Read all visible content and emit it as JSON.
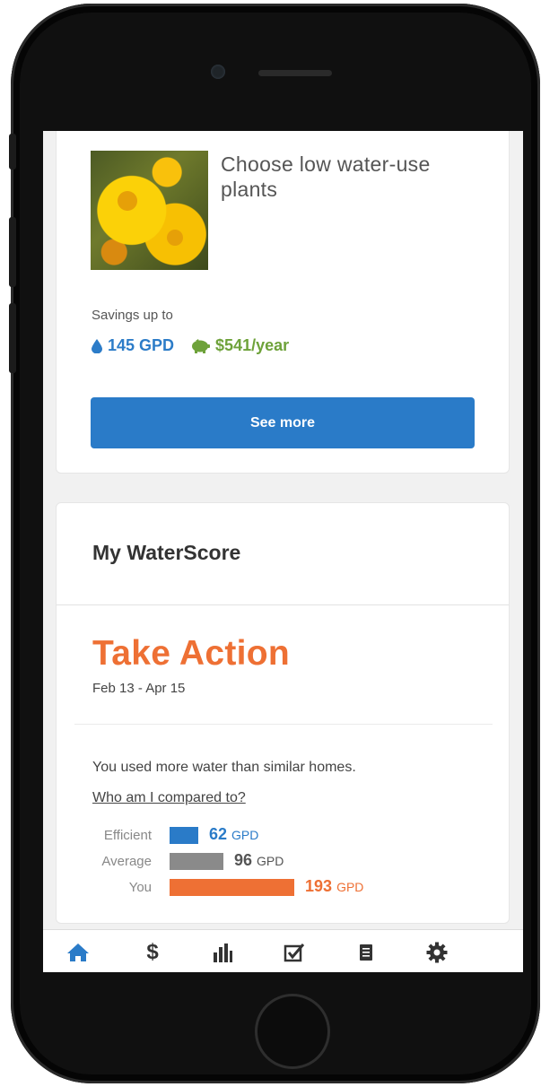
{
  "tip_card": {
    "title": "Choose low water-use plants",
    "savings_label": "Savings up to",
    "savings_gpd": "145 GPD",
    "savings_money": "$541/year",
    "button_label": "See more"
  },
  "waterscore": {
    "title": "My WaterScore",
    "status": "Take Action",
    "date_range": "Feb 13 - Apr 15",
    "message": "You used more water than similar homes.",
    "compare_link": "Who am I compared to?",
    "comparison": [
      {
        "label": "Efficient",
        "value": "62",
        "unit": "GPD",
        "color": "#2a7bc8"
      },
      {
        "label": "Average",
        "value": "96",
        "unit": "GPD",
        "color": "#8a8a8a"
      },
      {
        "label": "You",
        "value": "193",
        "unit": "GPD",
        "color": "#ee7034"
      }
    ]
  },
  "nav": {
    "items": [
      {
        "name": "home-icon",
        "active": true
      },
      {
        "name": "dollar-icon",
        "glyph": "$"
      },
      {
        "name": "bar-chart-icon"
      },
      {
        "name": "checklist-icon"
      },
      {
        "name": "document-icon"
      },
      {
        "name": "settings-icon"
      }
    ]
  },
  "colors": {
    "primary_blue": "#2a7bc8",
    "savings_green": "#6ea23a",
    "action_orange": "#ee7034",
    "average_gray": "#8a8a8a"
  }
}
